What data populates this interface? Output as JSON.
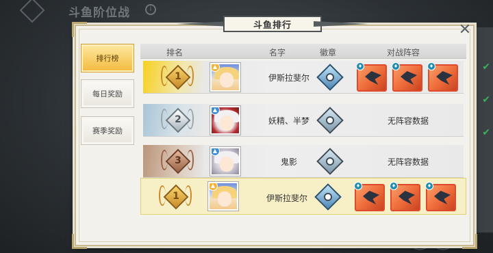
{
  "background": {
    "title": "斗鱼阶位战"
  },
  "dialog": {
    "title": "斗鱼排行",
    "close_icon": "close-icon"
  },
  "tabs": [
    {
      "label": "排行榜",
      "active": true
    },
    {
      "label": "每日奖励",
      "active": false
    },
    {
      "label": "赛季奖励",
      "active": false
    }
  ],
  "table": {
    "headers": {
      "rank": "排名",
      "name": "名字",
      "emblem": "徽章",
      "lineup": "对战阵容"
    },
    "rows": [
      {
        "rank": "1",
        "tier": "gold",
        "avatar": "blonde-girl",
        "name": "伊斯拉斐尔",
        "emblem": "blue-emblem",
        "lineup": [
          "hero-card",
          "hero-card",
          "hero-card"
        ],
        "lineup_text": ""
      },
      {
        "rank": "2",
        "tier": "silver",
        "avatar": "white-hair-girl",
        "name": "妖精、半梦",
        "emblem": "gray-emblem",
        "lineup": [],
        "lineup_text": "无阵容数据"
      },
      {
        "rank": "3",
        "tier": "bronze",
        "avatar": "ghost-girl",
        "name": "鬼影",
        "emblem": "gray-emblem",
        "lineup": [],
        "lineup_text": "无阵容数据"
      }
    ],
    "self_row": {
      "rank": "1",
      "tier": "gold",
      "avatar": "blonde-girl",
      "name": "伊斯拉斐尔",
      "emblem": "blue-emblem",
      "lineup": [
        "hero-card",
        "hero-card",
        "hero-card"
      ]
    }
  },
  "colors": {
    "gold_tab": "#f3b93d",
    "highlight_row": "#f7efc6",
    "hero_border": "#e04a2c"
  }
}
